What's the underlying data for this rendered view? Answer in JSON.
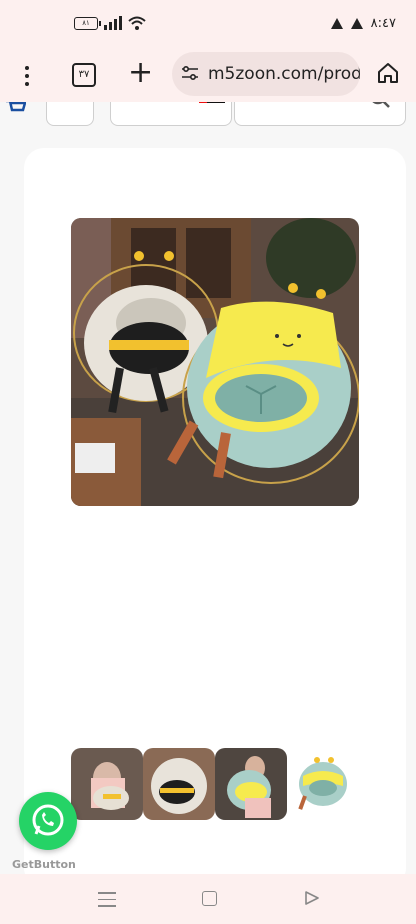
{
  "status_bar": {
    "battery_level": "٨١",
    "time": "٨:٤٧"
  },
  "browser": {
    "tab_count": "٣٧",
    "url": "m5zoon.com/prod"
  },
  "product": {
    "main_image": "bee-chair-cushion-photo",
    "thumbnails": [
      "thumb-woman-with-cushion",
      "thumb-bee-shark-cushion",
      "thumb-woman-seated-cushion",
      "thumb-bee-cushion-product"
    ]
  },
  "whatsapp": {
    "label": "GetButton"
  },
  "colors": {
    "whatsapp_green": "#25d366",
    "browser_bg": "#fdf0ef",
    "url_pill_bg": "#f1e2e1"
  }
}
